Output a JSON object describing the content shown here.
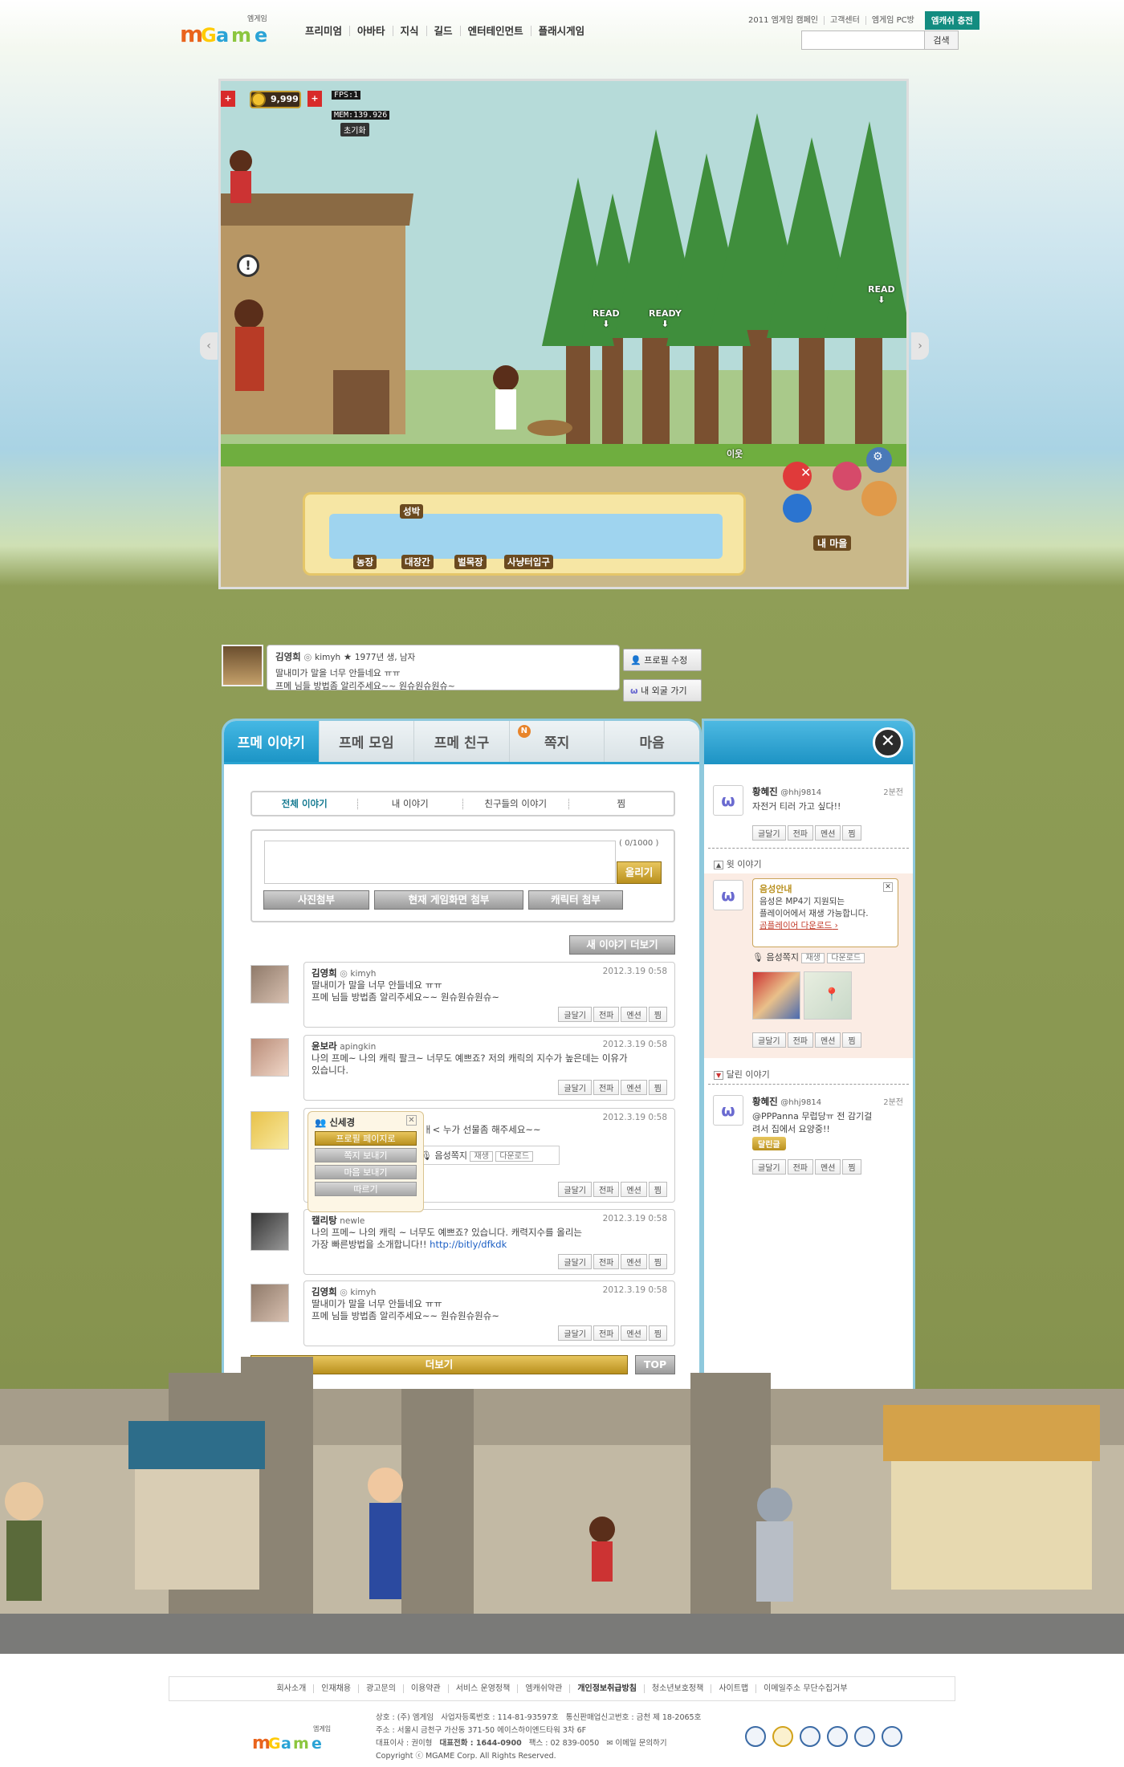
{
  "header": {
    "logo_small": "엠게임",
    "logo": "MGAME",
    "nav": [
      "프리미엄",
      "아바타",
      "지식",
      "길드",
      "엔터테인먼트",
      "플래시게임"
    ],
    "util": [
      "2011 엠게임 캠페인",
      "고객센터",
      "엠게임 PC방"
    ],
    "charge": "엠캐쉬 충전",
    "search_button": "검색"
  },
  "game": {
    "money": "9,999",
    "fps": "FPS:1",
    "mem": "MEM:139.926",
    "reset": "초기화",
    "ready_labels": [
      "READ",
      "READY",
      "READ"
    ],
    "tray_labels": [
      "성박",
      "농장",
      "대장간",
      "벌목장",
      "사냥터입구"
    ],
    "neighbor": "이웃",
    "my_town": "내 마을"
  },
  "profile": {
    "name": "김영희",
    "id": "kimyh",
    "meta": "1977년 생, 남자",
    "line1": "딸내미가 말을 너무 안들네요 ㅠㅠ",
    "line2": "프메 님들 방법좀 알리주세요~~ 원슈원슈원슈~",
    "edit_button": "프로필 수정",
    "outing_button": "내 외굴 가기"
  },
  "tabs": [
    "프메 이야기",
    "프메 모임",
    "프메 친구",
    "쪽지",
    "마음"
  ],
  "tab_badge": "N",
  "subtabs": [
    "전체 이야기",
    "내 이야기",
    "친구들의 이야기",
    "찜"
  ],
  "write": {
    "counter": "( 0/1000 )",
    "submit": "올리기",
    "attach_photo": "사진첨부",
    "attach_screen": "현재 게임화면 첨부",
    "attach_char": "캐릭터 첨부"
  },
  "more_stories": "새 이야기 더보기",
  "actions": [
    "글달기",
    "전파",
    "멘션",
    "찜"
  ],
  "posts": [
    {
      "name": "김영희",
      "id": "kimyh",
      "date": "2012.3.19 0:58",
      "text": [
        "딸내미가 말을 너무 안들네요 ㅠㅠ",
        "프메 님들 방법좀 알리주세요~~ 원슈원슈원슈~"
      ]
    },
    {
      "name": "윤보라",
      "id": "apingkin",
      "date": "2012.3.19 0:58",
      "text": [
        "나의 프메~ 나의 캐릭 팔크~ 너무도 예쁘죠? 저의 캐릭의 지수가 높은데는 이유가",
        "있습니다."
      ]
    },
    {
      "name": "신세경",
      "id": "",
      "date": "2012.3.19 0:58",
      "text": [
        "ㅐ< 누가 선물좀 해주세요~~"
      ]
    },
    {
      "name": "캘리탕",
      "id": "newle",
      "date": "2012.3.19 0:58",
      "text": [
        "나의 프메~ 나의 캐릭 ~ 너무도 예쁘죠? 있습니다. 캐력지수를 올리는",
        "가장 빠른방법을 소개합니다!!"
      ],
      "link": "http://bitly/dfkdk"
    },
    {
      "name": "김영희",
      "id": "kimyh",
      "date": "2012.3.19 0:58",
      "text": [
        "딸내미가 말을 너무 안들네요 ㅠㅠ",
        "프메 님들 방법좀 알리주세요~~ 원슈원슈원슈~"
      ]
    }
  ],
  "voice": {
    "label": "음성쪽지",
    "play": "재생",
    "download": "다운로드"
  },
  "popup": {
    "name": "신세경",
    "buttons": [
      "프로필 페이지로",
      "쪽지 보내기",
      "마음 보내기",
      "따르기"
    ]
  },
  "more_button": "더보기",
  "top_button": "TOP",
  "right": {
    "item1": {
      "name": "황혜진",
      "id": "@hhj9814",
      "time": "2분전",
      "text": "자전거 티러 가고 싶다!!"
    },
    "prev_label": "윗 이야기",
    "voice_notice": {
      "title": "음성안내",
      "text1": "음성은 MP4기 지원되는",
      "text2": "플레이어에서 재생 가능합니다.",
      "link": "곰플레이어 다운로드"
    },
    "next_label": "달린 이야기",
    "item2": {
      "name": "황혜진",
      "id": "@hhj9814",
      "time": "2분전",
      "text1": "@PPPanna 무럽당ㅠ 전 감기걸",
      "text2": "려서 집에서 요양중!!",
      "reply": "달린글"
    }
  },
  "footer": {
    "links": [
      "회사소개",
      "인재채용",
      "광고문의",
      "이용약관",
      "서비스 운영정책",
      "엠캐쉬약관",
      "개인정보취급방침",
      "청소년보호정책",
      "사이트맵",
      "이메일주소 무단수집거부"
    ],
    "company": "상호 : (주) 엠게임",
    "biz_no": "사업자등록번호 : 114-81-93597호",
    "telecom": "통신판매업신고번호 : 금천 제 18-2065호",
    "address": "주소 : 서울시 금천구 가산동 371-50 에이스하이엔드타워 3차 6F",
    "ceo": "대표이사 : 권이형",
    "phone": "대표전화 : 1644-0900",
    "fax": "팩스 : 02 839-0050",
    "email": "이메일 문의하기",
    "copyright": "Copyright ⓒ MGAME Corp. All Rights Reserved."
  },
  "colors": {
    "accent": "#1c95c6",
    "charge": "#138c80",
    "gold": "#b9901e"
  }
}
